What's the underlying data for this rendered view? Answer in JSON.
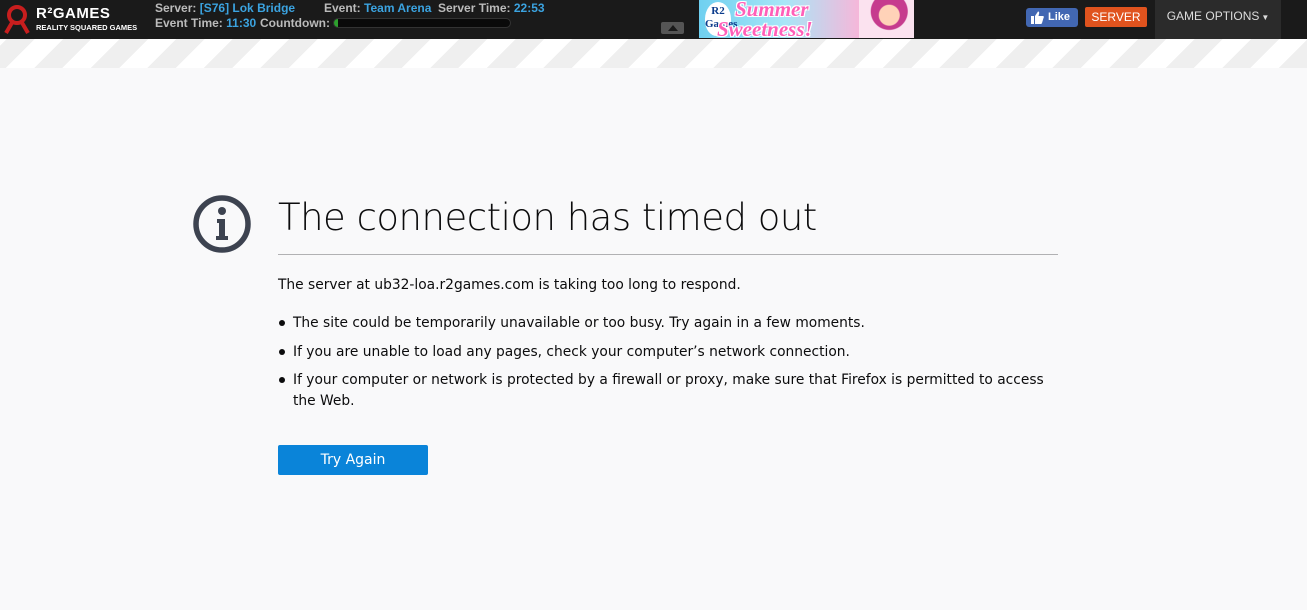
{
  "topbar": {
    "logo": {
      "name": "R²GAMES",
      "tagline": "REALITY SQUARED GAMES"
    },
    "server": {
      "label": "Server:",
      "value": "[S76] Lok Bridge"
    },
    "event": {
      "label": "Event:",
      "value": "Team Arena"
    },
    "server_time": {
      "label": "Server Time:",
      "value": "22:53"
    },
    "event_time": {
      "label": "Event Time:",
      "value": "11:30"
    },
    "countdown": {
      "label": "Countdown:",
      "progress": 0.02
    },
    "banner": {
      "badge": "R2 Games",
      "line1": "Summer",
      "line2": "Sweetness!"
    },
    "like_label": "Like",
    "server_button": "SERVER",
    "game_options": "GAME OPTIONS"
  },
  "error": {
    "title": "The connection has timed out",
    "description": "The server at ub32-loa.r2games.com is taking too long to respond.",
    "bullets": [
      "The site could be temporarily unavailable or too busy. Try again in a few moments.",
      "If you are unable to load any pages, check your computer’s network connection.",
      "If your computer or network is protected by a firewall or proxy, make sure that Firefox is permitted to access the Web."
    ],
    "try_again": "Try Again"
  },
  "colors": {
    "topbar_bg": "#1a1a1a",
    "accent_blue": "#3ba3e0",
    "server_orange": "#e0531e",
    "primary_button": "#0a84d9",
    "facebook": "#4267b2"
  },
  "icons": [
    "r2games-logo-icon",
    "collapse-arrow-icon",
    "thumbs-up-icon",
    "info-icon"
  ]
}
